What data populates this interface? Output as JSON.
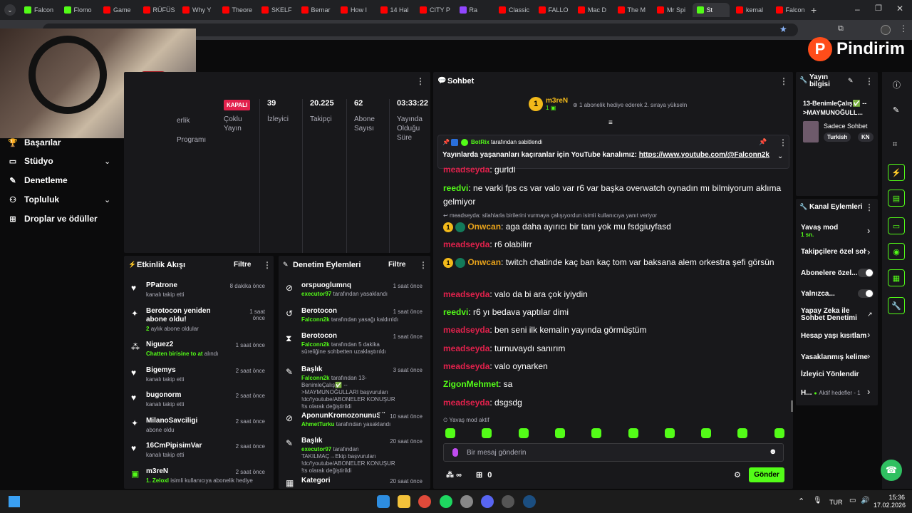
{
  "browser": {
    "tabs": [
      {
        "label": "Falcon",
        "color": "#53fc18"
      },
      {
        "label": "Flomo",
        "color": "#53fc18"
      },
      {
        "label": "Game",
        "color": "#ff0000"
      },
      {
        "label": "RÜFÜS",
        "color": "#ff0000"
      },
      {
        "label": "Why Y",
        "color": "#ff0000"
      },
      {
        "label": "Theore",
        "color": "#ff0000"
      },
      {
        "label": "SKELF",
        "color": "#ff0000"
      },
      {
        "label": "Bernar",
        "color": "#ff0000"
      },
      {
        "label": "How I",
        "color": "#ff0000"
      },
      {
        "label": "14 Hal",
        "color": "#ff0000"
      },
      {
        "label": "CITY P",
        "color": "#ff0000"
      },
      {
        "label": "Ra",
        "color": "#9146ff"
      },
      {
        "label": "Classic",
        "color": "#ff0000"
      },
      {
        "label": "FALLO",
        "color": "#ff0000"
      },
      {
        "label": "Mac D",
        "color": "#ff0000"
      },
      {
        "label": "The M",
        "color": "#ff0000"
      },
      {
        "label": "Mr Spi",
        "color": "#ff0000"
      },
      {
        "label": "St",
        "color": "#53fc18"
      },
      {
        "label": "kemal",
        "color": "#ff0000"
      },
      {
        "label": "Falcon",
        "color": "#ff0000"
      }
    ],
    "new_tab": "+"
  },
  "logo": {
    "text": "Pindirim",
    "letter": "P"
  },
  "sidebar": {
    "items": [
      {
        "label": "Başarılar",
        "icon": "trophy-icon",
        "chevron": false
      },
      {
        "label": "Stüdyo",
        "icon": "studio-icon",
        "chevron": true
      },
      {
        "label": "Denetleme",
        "icon": "wrench-icon",
        "chevron": false
      },
      {
        "label": "Topluluk",
        "icon": "people-icon",
        "chevron": true
      },
      {
        "label": "Droplar ve ödüller",
        "icon": "gift-icon",
        "chevron": false
      }
    ]
  },
  "stats": {
    "partial_label_1": "erlik",
    "partial_label_2": "Programı",
    "status_badge": "KAPALI",
    "status_label": "Çoklu Yayın",
    "items": [
      {
        "value": "39",
        "label": "İzleyici"
      },
      {
        "value": "20.225",
        "label": "Takipçi"
      },
      {
        "value": "62",
        "label": "Abone Sayısı"
      },
      {
        "value": "03:33:22",
        "label": "Yayında Olduğu Süre"
      }
    ]
  },
  "activity": {
    "title": "Etkinlik Akışı",
    "filter": "Filtre",
    "items": [
      {
        "name": "PPatrone",
        "sub": "kanalı takip etti",
        "time": "8 dakika önce",
        "icon": "heart-icon"
      },
      {
        "name": "Berotocon yeniden abone oldu!",
        "sub": "aylık abone oldular",
        "sub_prefix": "2",
        "time": "1 saat önce",
        "icon": "sparkle-icon"
      },
      {
        "name": "Niguez2",
        "sub_green": "Chatten birisine to at",
        "sub": "alındı",
        "time": "1 saat önce",
        "icon": "drop-icon"
      },
      {
        "name": "Bigemys",
        "sub": "kanalı takip etti",
        "time": "2 saat önce",
        "icon": "heart-icon"
      },
      {
        "name": "bugonorm",
        "sub": "kanalı takip etti",
        "time": "2 saat önce",
        "icon": "heart-icon"
      },
      {
        "name": "MilanoSavciligi",
        "sub": "abone oldu",
        "time": "2 saat önce",
        "icon": "sparkle-icon"
      },
      {
        "name": "16CmPipisimVar",
        "sub": "kanalı takip etti",
        "time": "2 saat önce",
        "icon": "heart-icon"
      },
      {
        "name": "m3reN",
        "sub_green": "1. Zeloxl",
        "sub": "isimli kullanıcıya abonelik hediye",
        "time": "2 saat önce",
        "icon": "gift-icon"
      }
    ]
  },
  "moderation": {
    "title": "Denetim Eylemleri",
    "filter": "Filtre",
    "items": [
      {
        "name": "orspuoglumnq",
        "actor": "executor97",
        "text": "tarafından yasaklandı",
        "time": "1 saat önce",
        "icon": "ban-icon"
      },
      {
        "name": "Berotocon",
        "actor": "Falconn2k",
        "text": "tarafından yasağı kaldırıldı",
        "time": "1 saat önce",
        "icon": "undo-icon"
      },
      {
        "name": "Berotocon",
        "actor": "Falconn2k",
        "text": "tarafından 5 dakika süreliğine sohbetten uzaklaştırıldı",
        "time": "1 saat önce",
        "icon": "hourglass-icon"
      },
      {
        "name": "Başlık",
        "actor": "Falconn2k",
        "text": "tarafından 13-BenimleÇalış✅ -->MAYMUNOĞULLARI başvuruları !dc/!youtube/ABONELER KONUŞUR !ts olarak değiştirildi",
        "time": "3 saat önce",
        "icon": "edit-title-icon"
      },
      {
        "name": "AponunKromozonunuSiken",
        "actor": "AhmetTurku",
        "text": "tarafından yasaklandı",
        "time": "10 saat önce",
        "icon": "ban-icon"
      },
      {
        "name": "Başlık",
        "actor": "executor97",
        "text": "tarafından TAKILMAÇ→Ekip başvuruları !dc/!youtube/ABONELER KONUŞUR !ts olarak değiştirildi",
        "time": "20 saat önce",
        "icon": "edit-title-icon"
      },
      {
        "name": "Kategori",
        "actor": "",
        "text": "",
        "time": "20 saat önce",
        "icon": "category-icon"
      }
    ]
  },
  "chat": {
    "title": "Sohbet",
    "gifter_name": "m3reN",
    "gifter_count": "1",
    "gifter_rank": "1",
    "gifter_msg": "1 abonelik hediye ederek 2. sıraya yükseln",
    "pinned_by": "BotRix",
    "pinned_by_text": "tarafından sabitlendi",
    "pinned_msg": "Yayınlarda yaşananları kaçıranlar için YouTube kanalımız:",
    "pinned_link": "https://www.youtube.com/@Falconn2k",
    "reply_note": "meadseyda: silahlarla birilerini vurmaya çalışıyordun isimli kullanıcıya yanıt veriyor",
    "messages": [
      {
        "user": "meadseyda",
        "color": "red",
        "text": "gurldl",
        "badges": false
      },
      {
        "user": "reedvi",
        "color": "green",
        "text": "ne varki fps cs var valo var r6 var başka overwatch oynadın mı bilmiyorum aklıma gelmiyor",
        "badges": false
      },
      {
        "user": "Onwcan",
        "color": "orange",
        "text": "aga daha ayırıcı bir tanı yok mu fsdgiuyfasd",
        "badges": true
      },
      {
        "user": "meadseyda",
        "color": "red",
        "text": "r6 olabilirr",
        "badges": false
      },
      {
        "user": "Onwcan",
        "color": "orange",
        "text": "twitch chatinde kaç ban kaç tom var baksana alem orkestra şefi görsün",
        "badges": true
      },
      {
        "user": "meadseyda",
        "color": "red",
        "text": "valo da bi ara çok iyiydin",
        "badges": false
      },
      {
        "user": "reedvi",
        "color": "green",
        "text": "r6 yı bedava yaptılar dimi",
        "badges": false
      },
      {
        "user": "meadseyda",
        "color": "red",
        "text": "ben seni ilk kemalin yayında görmüştüm",
        "badges": false
      },
      {
        "user": "meadseyda",
        "color": "red",
        "text": "turnuvaydı sanırım",
        "badges": false
      },
      {
        "user": "meadseyda",
        "color": "red",
        "text": "valo oynarken",
        "badges": false
      },
      {
        "user": "ZigonMehmet",
        "color": "green",
        "text": "sa",
        "badges": false
      },
      {
        "user": "meadseyda",
        "color": "red",
        "text": "dsgsdg",
        "badges": false
      }
    ],
    "slow_mode": "Yavaş mod aktif",
    "placeholder": "Bir mesaj gönderin",
    "infinity": "∞",
    "count": "0",
    "send": "Gönder"
  },
  "stream_info": {
    "title": "Yayın bilgisi",
    "stream_title": "13-BenimleÇalış✅ -->MAYMUNOĞULL...",
    "mode": "Sadece Sohbet",
    "tags": [
      "Turkish",
      "KN"
    ]
  },
  "channel_actions": {
    "title": "Kanal Eylemleri",
    "slow_mode": "Yavaş mod",
    "slow_value": "1 sn.",
    "followers_only": "Takipçilere özel soh",
    "subs_only": "Abonelere özel...",
    "only": "Yalnızca...",
    "ai": "Yapay Zeka ile Sohbet Denetimi",
    "account_age": "Hesap yaşı kısıtlama",
    "banned_words": "Yasaklanmış kelime",
    "redirect": "İzleyici Yönlendir",
    "goals_prefix": "H...",
    "goals": "Aktif hedefler - 1"
  },
  "taskbar": {
    "lang": "TUR",
    "time": "15:36",
    "date": "17.02.2026"
  }
}
